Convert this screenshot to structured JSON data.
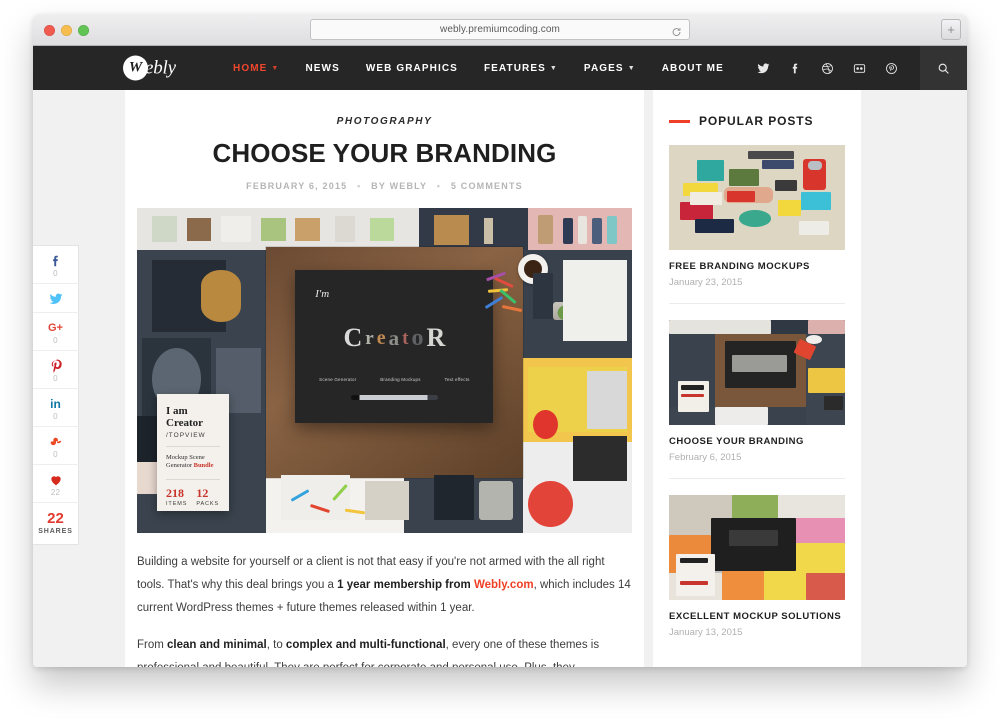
{
  "browser": {
    "url": "webly.premiumcoding.com",
    "reload_icon": "reload-icon",
    "newtab_label": "+",
    "traffic_lights": [
      "close",
      "minimize",
      "zoom"
    ]
  },
  "site": {
    "logo_initial": "W",
    "logo_word": "ebly",
    "nav": [
      {
        "label": "HOME",
        "active": true,
        "has_caret": true
      },
      {
        "label": "NEWS",
        "active": false,
        "has_caret": false
      },
      {
        "label": "WEB GRAPHICS",
        "active": false,
        "has_caret": false
      },
      {
        "label": "FEATURES",
        "active": false,
        "has_caret": true
      },
      {
        "label": "PAGES",
        "active": false,
        "has_caret": true
      },
      {
        "label": "ABOUT ME",
        "active": false,
        "has_caret": false
      }
    ],
    "socials": [
      "twitter-icon",
      "facebook-icon",
      "dribbble-icon",
      "flickr-icon",
      "pinterest-icon"
    ],
    "search_icon": "search-icon",
    "accent_color": "#ef3f26",
    "nav_bg": "#262626"
  },
  "share_rail": {
    "items": [
      {
        "network": "facebook",
        "glyph": "f",
        "count": "0",
        "color": "#3b5998"
      },
      {
        "network": "twitter",
        "glyph": "t",
        "count": "",
        "color": "#4fc3f7"
      },
      {
        "network": "googleplus",
        "glyph": "G+",
        "count": "0",
        "color": "#e1443a"
      },
      {
        "network": "pinterest",
        "glyph": "P",
        "count": "0",
        "color": "#cb2027"
      },
      {
        "network": "linkedin",
        "glyph": "in",
        "count": "0",
        "color": "#0e76a8"
      },
      {
        "network": "stumbleupon",
        "glyph": "su",
        "count": "0",
        "color": "#eb4924"
      },
      {
        "network": "likes",
        "glyph": "heart",
        "count": "22",
        "color": "#d52b1e"
      }
    ],
    "total_count": "22",
    "total_label": "SHARES"
  },
  "post": {
    "category": "PHOTOGRAPHY",
    "title": "CHOOSE YOUR BRANDING",
    "date": "FEBRUARY 6, 2015",
    "author": "BY WEBLY",
    "comments": "5 COMMENTS",
    "separator": "•",
    "featured_overlay": {
      "title_line1": "I am",
      "title_line2": "Creator",
      "subtitle": "/TOPVIEW",
      "desc_line1": "Mockup Scene",
      "desc_line2": "Generator ",
      "desc_highlight": "Bundle",
      "stat1_number": "218",
      "stat1_label": "ITEMS",
      "stat2_number": "12",
      "stat2_label": "PACKS"
    },
    "featured_board": {
      "im": "I'm",
      "word": "Creator",
      "tag1": "Scene Generator",
      "tag2": "Branding Mockups",
      "tag3": "Text effects"
    },
    "paragraphs": [
      {
        "parts": [
          {
            "t": "Building a website for yourself or a client is not that easy if you're not armed with the all right tools. That's why this deal brings you a ",
            "style": "normal"
          },
          {
            "t": "1 year membership from ",
            "style": "bold"
          },
          {
            "t": "Webly.com",
            "style": "link"
          },
          {
            "t": ", which includes 14 current WordPress themes + future themes released within 1 year.",
            "style": "normal"
          }
        ]
      },
      {
        "parts": [
          {
            "t": "From ",
            "style": "normal"
          },
          {
            "t": "clean and minimal",
            "style": "bold"
          },
          {
            "t": ", to ",
            "style": "normal"
          },
          {
            "t": "complex and multi-functional",
            "style": "bold"
          },
          {
            "t": ", every one of these themes is professional and beautiful. They are perfect for corporate and personal use. Plus, they",
            "style": "normal"
          }
        ]
      }
    ]
  },
  "sidebar": {
    "widget_title": "POPULAR POSTS",
    "posts": [
      {
        "title": "FREE BRANDING MOCKUPS",
        "date": "January 23, 2015",
        "thumb": "branding-mockups-thumb"
      },
      {
        "title": "CHOOSE YOUR BRANDING",
        "date": "February 6, 2015",
        "thumb": "creator-desk-thumb"
      },
      {
        "title": "EXCELLENT MOCKUP SOLUTIONS",
        "date": "January 13, 2015",
        "thumb": "isometric-desk-thumb"
      }
    ]
  }
}
